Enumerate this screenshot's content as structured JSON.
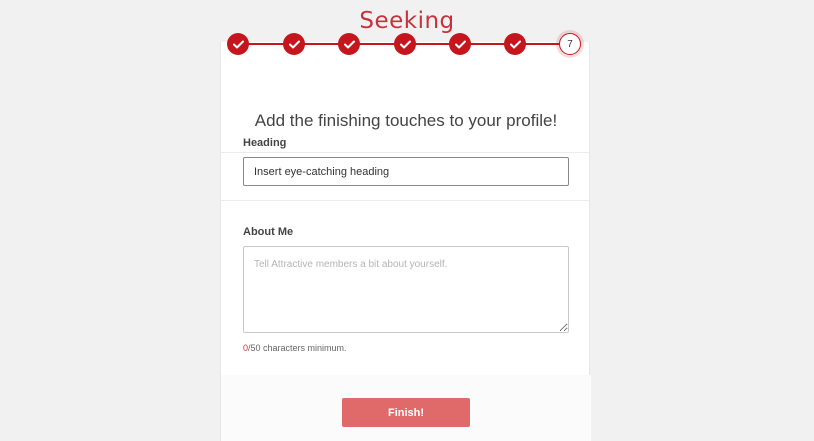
{
  "brand": {
    "logo_text": "Seeking",
    "accent_color": "#c5161d"
  },
  "progress": {
    "total_steps": 7,
    "completed_steps": 6,
    "current_step_label": "7"
  },
  "card": {
    "title": "Add the finishing touches to your profile!"
  },
  "heading_field": {
    "label": "Heading",
    "value": "Insert eye-catching heading"
  },
  "about_field": {
    "label": "About Me",
    "placeholder": "Tell Attractive members a bit about yourself.",
    "count_current": "0",
    "count_rest": "/50 characters minimum."
  },
  "actions": {
    "finish_label": "Finish!",
    "finish_color": "#e06a6a"
  }
}
